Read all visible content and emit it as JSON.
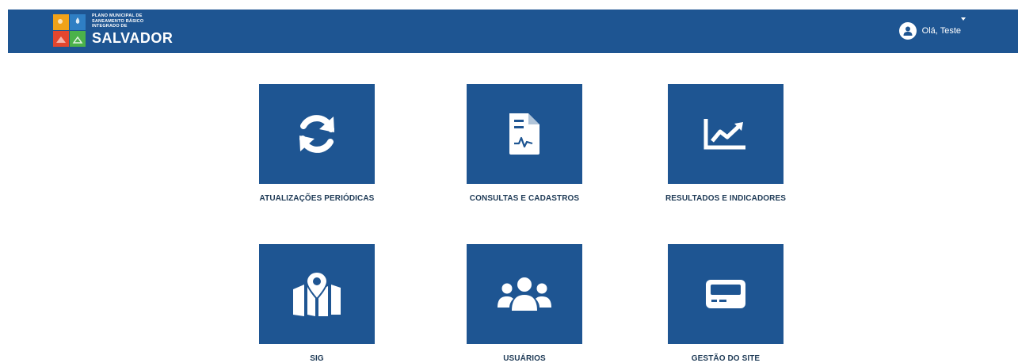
{
  "header": {
    "logo": {
      "line1": "PLANO MUNICIPAL DE",
      "line2": "SANEAMENTO BÁSICO",
      "line3": "INTEGRADO DE",
      "big": "SALVADOR"
    },
    "user_greeting": "Olá, Teste"
  },
  "tiles": [
    {
      "label": "ATUALIZAÇÕES PERIÓDICAS",
      "icon": "refresh-icon"
    },
    {
      "label": "CONSULTAS E CADASTROS",
      "icon": "document-icon"
    },
    {
      "label": "RESULTADOS E INDICADORES",
      "icon": "chart-line-icon"
    },
    {
      "label": "SIG",
      "icon": "map-marker-icon"
    },
    {
      "label": "USUÁRIOS",
      "icon": "users-icon"
    },
    {
      "label": "GESTÃO DO SITE",
      "icon": "site-admin-icon"
    }
  ],
  "colors": {
    "primary": "#1e5592",
    "label": "#1f3b57"
  }
}
